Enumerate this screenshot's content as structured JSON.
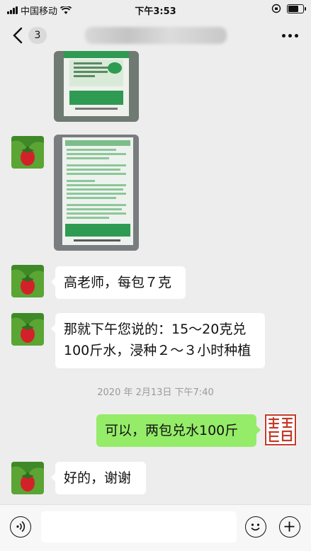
{
  "status_bar": {
    "carrier": "中国移动",
    "time": "下午3:53",
    "battery_level": 0.75
  },
  "nav": {
    "back_icon": "chevron-left-icon",
    "unread_count": "3",
    "more_icon": "more-dots-icon"
  },
  "messages": [
    {
      "type": "image",
      "side": "left",
      "content": "pesticide-package-front-photo"
    },
    {
      "type": "image",
      "side": "left",
      "content": "pesticide-package-back-photo"
    },
    {
      "type": "text",
      "side": "left",
      "text": "高老师，每包７克"
    },
    {
      "type": "text",
      "side": "left",
      "lines": [
        "那就下午您说的：15～20克兑",
        "100斤水，浸种２～３小时种植"
      ]
    },
    {
      "type": "text",
      "side": "right",
      "text": "可以，两包兑水100斤"
    },
    {
      "type": "text",
      "side": "left",
      "text": "好的，谢谢"
    }
  ],
  "timestamp": "2020 年 2月13日 下午7:40",
  "input_bar": {
    "voice_icon": "voice-icon",
    "emoji_icon": "emoji-icon",
    "plus_icon": "plus-icon"
  },
  "colors": {
    "background": "#ededed",
    "own_bubble": "#95ec69",
    "other_bubble": "#ffffff"
  }
}
